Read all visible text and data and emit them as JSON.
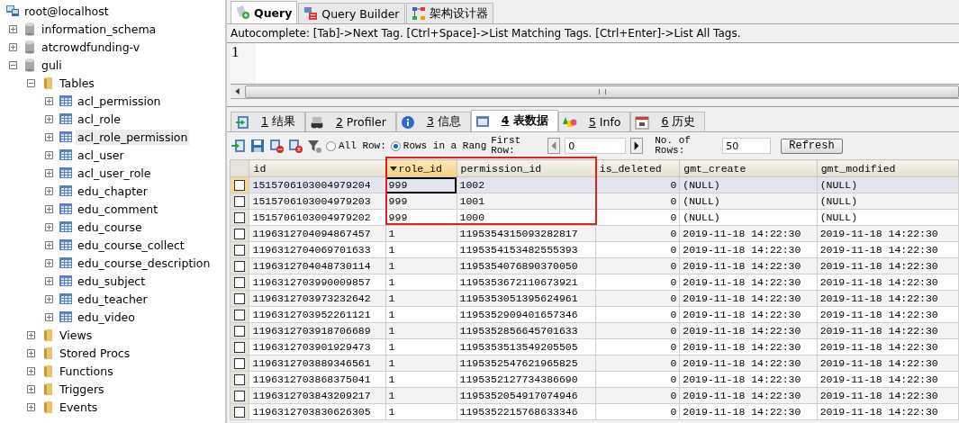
{
  "tree": [
    {
      "label": "root@localhost",
      "kind": "server",
      "selected": false,
      "children": [
        {
          "label": "information_schema",
          "kind": "database",
          "expanded": false,
          "selected": false
        },
        {
          "label": "atcrowdfunding-v",
          "kind": "database",
          "expanded": false,
          "selected": false
        },
        {
          "label": "guli",
          "kind": "database",
          "expanded": true,
          "selected": false,
          "children": [
            {
              "label": "Tables",
              "kind": "folder",
              "expanded": true,
              "selected": false,
              "children": [
                {
                  "label": "acl_permission",
                  "kind": "table",
                  "expanded": false,
                  "selected": false
                },
                {
                  "label": "acl_role",
                  "kind": "table",
                  "expanded": false,
                  "selected": false
                },
                {
                  "label": "acl_role_permission",
                  "kind": "table",
                  "expanded": false,
                  "selected": true
                },
                {
                  "label": "acl_user",
                  "kind": "table",
                  "expanded": false,
                  "selected": false
                },
                {
                  "label": "acl_user_role",
                  "kind": "table",
                  "expanded": false,
                  "selected": false
                },
                {
                  "label": "edu_chapter",
                  "kind": "table",
                  "expanded": false,
                  "selected": false
                },
                {
                  "label": "edu_comment",
                  "kind": "table",
                  "expanded": false,
                  "selected": false
                },
                {
                  "label": "edu_course",
                  "kind": "table",
                  "expanded": false,
                  "selected": false
                },
                {
                  "label": "edu_course_collect",
                  "kind": "table",
                  "expanded": false,
                  "selected": false
                },
                {
                  "label": "edu_course_description",
                  "kind": "table",
                  "expanded": false,
                  "selected": false
                },
                {
                  "label": "edu_subject",
                  "kind": "table",
                  "expanded": false,
                  "selected": false
                },
                {
                  "label": "edu_teacher",
                  "kind": "table",
                  "expanded": false,
                  "selected": false
                },
                {
                  "label": "edu_video",
                  "kind": "table",
                  "expanded": false,
                  "selected": false
                }
              ]
            },
            {
              "label": "Views",
              "kind": "folder",
              "expanded": false,
              "selected": false
            },
            {
              "label": "Stored Procs",
              "kind": "folder",
              "expanded": false,
              "selected": false
            },
            {
              "label": "Functions",
              "kind": "folder",
              "expanded": false,
              "selected": false
            },
            {
              "label": "Triggers",
              "kind": "folder",
              "expanded": false,
              "selected": false
            },
            {
              "label": "Events",
              "kind": "folder",
              "expanded": false,
              "selected": false
            }
          ]
        }
      ]
    }
  ],
  "editor_tabs": [
    {
      "label": "Query",
      "kind": "query",
      "selected": true
    },
    {
      "label": "Query Builder",
      "kind": "builder",
      "selected": false
    },
    {
      "label": "架构设计器",
      "kind": "schema",
      "selected": false
    }
  ],
  "autocomplete_hint": "Autocomplete: [Tab]->Next Tag. [Ctrl+Space]->List Matching Tags. [Ctrl+Enter]->List All Tags.",
  "editor": {
    "line_numbers": [
      "1"
    ]
  },
  "result_tabs": [
    {
      "number": "1",
      "label": "结果",
      "kind": "result",
      "selected": false
    },
    {
      "number": "2",
      "label": "Profiler",
      "kind": "profiler",
      "selected": false
    },
    {
      "number": "3",
      "label": "信息",
      "kind": "info",
      "selected": false
    },
    {
      "number": "4",
      "label": "表数据",
      "kind": "table",
      "selected": true
    },
    {
      "number": "5",
      "label": "Info",
      "kind": "shapes",
      "selected": false
    },
    {
      "number": "6",
      "label": "历史",
      "kind": "history",
      "selected": false
    }
  ],
  "row_options": [
    {
      "label": "All Row:",
      "selected": false
    },
    {
      "label": "Rows in a Rang",
      "selected": true
    }
  ],
  "first_row": {
    "label": "First Row:",
    "value": "0"
  },
  "row_count": {
    "label": "No. of Rows:",
    "value": "50"
  },
  "refresh_button": "Refresh",
  "table": {
    "columns": [
      {
        "label": "id",
        "sorted": false
      },
      {
        "label": "role_id",
        "sorted": true
      },
      {
        "label": "permission_id",
        "sorted": false
      },
      {
        "label": "is_deleted",
        "sorted": false
      },
      {
        "label": "gmt_create",
        "sorted": false
      },
      {
        "label": "gmt_modified",
        "sorted": false
      }
    ],
    "rows": [
      {
        "selected": true,
        "checked": false,
        "cells": [
          {
            "text": "1515706103004979204",
            "focused": false
          },
          {
            "text": "999",
            "focused": true
          },
          {
            "text": "1002",
            "focused": false
          },
          {
            "text": "0",
            "focused": false
          },
          {
            "text": "(NULL)",
            "focused": false
          },
          {
            "text": "(NULL)",
            "focused": false
          }
        ]
      },
      {
        "selected": false,
        "checked": false,
        "cells": [
          {
            "text": "1515706103004979203",
            "focused": false
          },
          {
            "text": "999",
            "focused": false
          },
          {
            "text": "1001",
            "focused": false
          },
          {
            "text": "0",
            "focused": false
          },
          {
            "text": "(NULL)",
            "focused": false
          },
          {
            "text": "(NULL)",
            "focused": false
          }
        ]
      },
      {
        "selected": false,
        "checked": false,
        "cells": [
          {
            "text": "1515706103004979202",
            "focused": false
          },
          {
            "text": "999",
            "focused": false
          },
          {
            "text": "1000",
            "focused": false
          },
          {
            "text": "0",
            "focused": false
          },
          {
            "text": "(NULL)",
            "focused": false
          },
          {
            "text": "(NULL)",
            "focused": false
          }
        ]
      },
      {
        "selected": false,
        "checked": false,
        "cells": [
          {
            "text": "1196312704094867457",
            "focused": false
          },
          {
            "text": "1",
            "focused": false
          },
          {
            "text": "1195354315093282817",
            "focused": false
          },
          {
            "text": "0",
            "focused": false
          },
          {
            "text": "2019-11-18 14:22:30",
            "focused": false
          },
          {
            "text": "2019-11-18 14:22:30",
            "focused": false
          }
        ]
      },
      {
        "selected": false,
        "checked": false,
        "cells": [
          {
            "text": "1196312704069701633",
            "focused": false
          },
          {
            "text": "1",
            "focused": false
          },
          {
            "text": "1195354153482555393",
            "focused": false
          },
          {
            "text": "0",
            "focused": false
          },
          {
            "text": "2019-11-18 14:22:30",
            "focused": false
          },
          {
            "text": "2019-11-18 14:22:30",
            "focused": false
          }
        ]
      },
      {
        "selected": false,
        "checked": false,
        "cells": [
          {
            "text": "1196312704048730114",
            "focused": false
          },
          {
            "text": "1",
            "focused": false
          },
          {
            "text": "1195354076890370050",
            "focused": false
          },
          {
            "text": "0",
            "focused": false
          },
          {
            "text": "2019-11-18 14:22:30",
            "focused": false
          },
          {
            "text": "2019-11-18 14:22:30",
            "focused": false
          }
        ]
      },
      {
        "selected": false,
        "checked": false,
        "cells": [
          {
            "text": "1196312703990009857",
            "focused": false
          },
          {
            "text": "1",
            "focused": false
          },
          {
            "text": "1195353672110673921",
            "focused": false
          },
          {
            "text": "0",
            "focused": false
          },
          {
            "text": "2019-11-18 14:22:30",
            "focused": false
          },
          {
            "text": "2019-11-18 14:22:30",
            "focused": false
          }
        ]
      },
      {
        "selected": false,
        "checked": false,
        "cells": [
          {
            "text": "1196312703973232642",
            "focused": false
          },
          {
            "text": "1",
            "focused": false
          },
          {
            "text": "1195353051395624961",
            "focused": false
          },
          {
            "text": "0",
            "focused": false
          },
          {
            "text": "2019-11-18 14:22:30",
            "focused": false
          },
          {
            "text": "2019-11-18 14:22:30",
            "focused": false
          }
        ]
      },
      {
        "selected": false,
        "checked": false,
        "cells": [
          {
            "text": "1196312703952261121",
            "focused": false
          },
          {
            "text": "1",
            "focused": false
          },
          {
            "text": "1195352909401657346",
            "focused": false
          },
          {
            "text": "0",
            "focused": false
          },
          {
            "text": "2019-11-18 14:22:30",
            "focused": false
          },
          {
            "text": "2019-11-18 14:22:30",
            "focused": false
          }
        ]
      },
      {
        "selected": false,
        "checked": false,
        "cells": [
          {
            "text": "1196312703918706689",
            "focused": false
          },
          {
            "text": "1",
            "focused": false
          },
          {
            "text": "1195352856645701633",
            "focused": false
          },
          {
            "text": "0",
            "focused": false
          },
          {
            "text": "2019-11-18 14:22:30",
            "focused": false
          },
          {
            "text": "2019-11-18 14:22:30",
            "focused": false
          }
        ]
      },
      {
        "selected": false,
        "checked": false,
        "cells": [
          {
            "text": "1196312703901929473",
            "focused": false
          },
          {
            "text": "1",
            "focused": false
          },
          {
            "text": "1195353513549205505",
            "focused": false
          },
          {
            "text": "0",
            "focused": false
          },
          {
            "text": "2019-11-18 14:22:30",
            "focused": false
          },
          {
            "text": "2019-11-18 14:22:30",
            "focused": false
          }
        ]
      },
      {
        "selected": false,
        "checked": false,
        "cells": [
          {
            "text": "1196312703889346561",
            "focused": false
          },
          {
            "text": "1",
            "focused": false
          },
          {
            "text": "1195352547621965825",
            "focused": false
          },
          {
            "text": "0",
            "focused": false
          },
          {
            "text": "2019-11-18 14:22:30",
            "focused": false
          },
          {
            "text": "2019-11-18 14:22:30",
            "focused": false
          }
        ]
      },
      {
        "selected": false,
        "checked": false,
        "cells": [
          {
            "text": "1196312703868375041",
            "focused": false
          },
          {
            "text": "1",
            "focused": false
          },
          {
            "text": "1195352127734386690",
            "focused": false
          },
          {
            "text": "0",
            "focused": false
          },
          {
            "text": "2019-11-18 14:22:30",
            "focused": false
          },
          {
            "text": "2019-11-18 14:22:30",
            "focused": false
          }
        ]
      },
      {
        "selected": false,
        "checked": false,
        "cells": [
          {
            "text": "1196312703843209217",
            "focused": false
          },
          {
            "text": "1",
            "focused": false
          },
          {
            "text": "1195352054917074946",
            "focused": false
          },
          {
            "text": "0",
            "focused": false
          },
          {
            "text": "2019-11-18 14:22:30",
            "focused": false
          },
          {
            "text": "2019-11-18 14:22:30",
            "focused": false
          }
        ]
      },
      {
        "selected": false,
        "checked": false,
        "cells": [
          {
            "text": "1196312703830626305",
            "focused": false
          },
          {
            "text": "1",
            "focused": false
          },
          {
            "text": "1195352215768633346",
            "focused": false
          },
          {
            "text": "0",
            "focused": false
          },
          {
            "text": "2019-11-18 14:22:30",
            "focused": false
          },
          {
            "text": "2019-11-18 14:22:30",
            "focused": false
          }
        ]
      }
    ]
  }
}
